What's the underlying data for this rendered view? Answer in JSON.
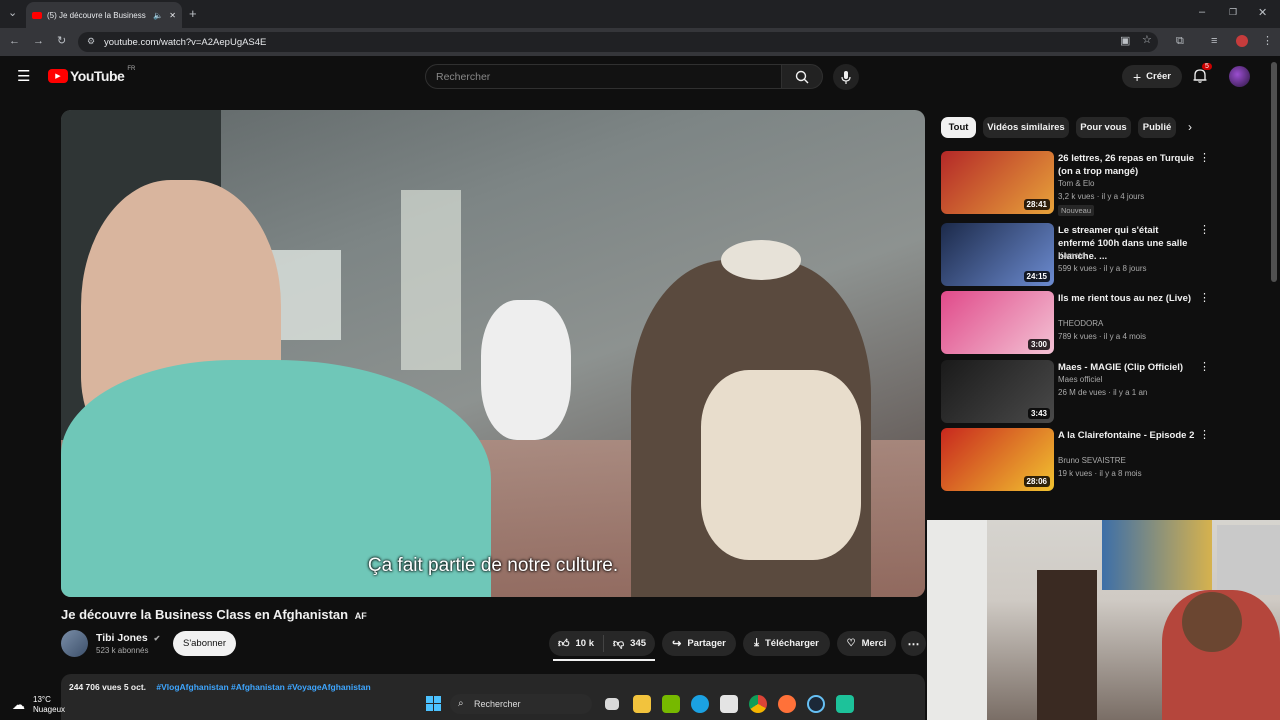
{
  "browser": {
    "tab_title": "(5) Je découvre la Business",
    "url": "youtube.com/watch?v=A2AepUgAS4E"
  },
  "header": {
    "logo_text": "YouTube",
    "logo_region": "FR",
    "search_placeholder": "Rechercher",
    "create_label": "Créer",
    "notification_count": "5"
  },
  "video": {
    "subtitle": "Ça fait partie de notre culture.",
    "title": "Je découvre la Business Class en Afghanistan",
    "title_flag": "AF",
    "channel": "Tibi Jones",
    "subscribers": "523 k abonnés",
    "subscribe_label": "S'abonner",
    "likes": "10 k",
    "dislikes": "345",
    "share_label": "Partager",
    "download_label": "Télécharger",
    "thanks_label": "Merci",
    "views_date": "244 706 vues  5 oct.",
    "hashtags": "#VlogAfghanistan #Afghanistan #VoyageAfghanistan"
  },
  "chips": [
    "Tout",
    "Vidéos similaires",
    "Pour vous",
    "Publié"
  ],
  "recommended": [
    {
      "title": "26 lettres, 26 repas en Turquie (on a trop mangé)",
      "channel": "Tom & Elo",
      "meta": "3,2 k vues · il y a 4 jours",
      "badge": "Nouveau",
      "duration": "28:41",
      "color1": "#b42828",
      "color2": "#e8a33a"
    },
    {
      "title": "Le streamer qui s'était enfermé 100h dans une salle blanche. ...",
      "channel": "Kameto",
      "meta": "599 k vues · il y a 8 jours",
      "duration": "24:15",
      "color1": "#1c2a4a",
      "color2": "#6c8bd0"
    },
    {
      "title": "Ils me rient tous au nez (Live)",
      "channel": "THEODORA",
      "meta": "789 k vues · il y a 4 mois",
      "duration": "3:00",
      "color1": "#e04a8a",
      "color2": "#f3c2d4"
    },
    {
      "title": "Maes - MAGIE (Clip Officiel)",
      "channel": "Maes officiel",
      "meta": "26 M de vues · il y a 1 an",
      "duration": "3:43",
      "color1": "#1a1a1a",
      "color2": "#4a4a4a"
    },
    {
      "title": "A la Clairefontaine - Episode 2",
      "channel": "Bruno SEVAISTRE",
      "meta": "19 k vues · il y a 8 mois",
      "duration": "28:06",
      "color1": "#c8281e",
      "color2": "#f2c330"
    }
  ],
  "taskbar": {
    "temperature": "13°C",
    "weather": "Nuageux",
    "search": "Rechercher"
  }
}
